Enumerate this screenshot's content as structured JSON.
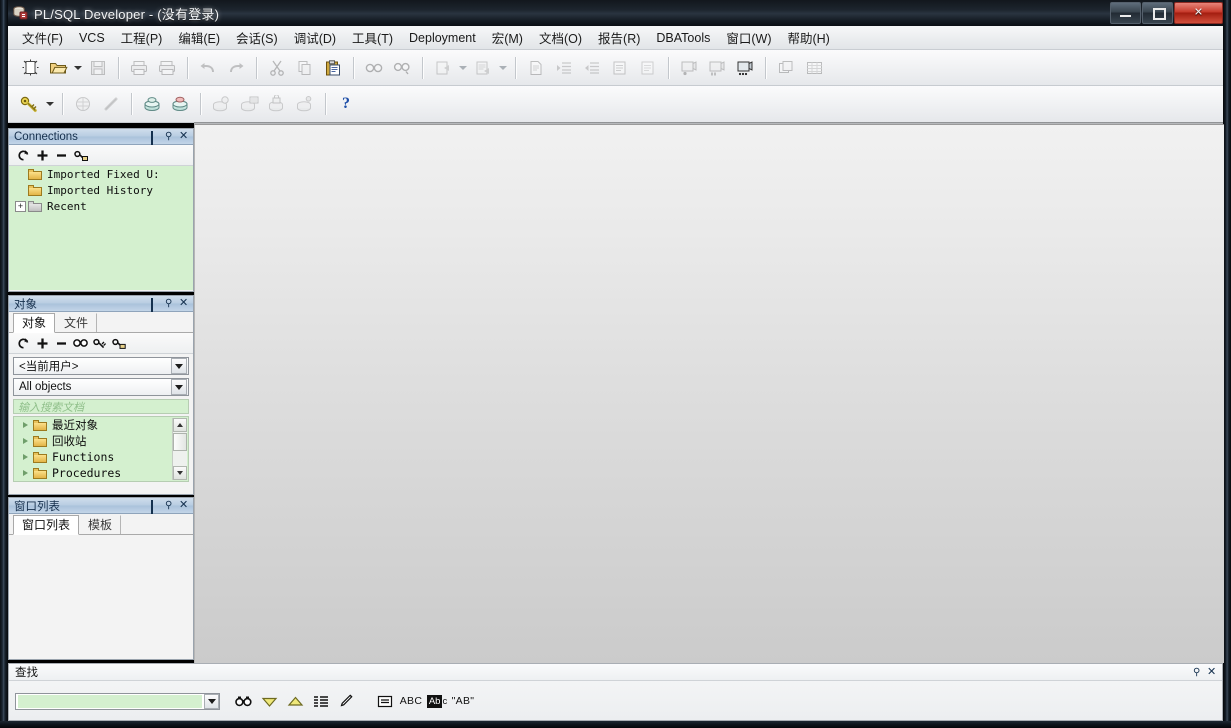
{
  "window": {
    "title": "PL/SQL Developer - (没有登录)",
    "app_icon": "plsql-developer-icon",
    "minimize": "—",
    "maximize": "❐",
    "close": "✕"
  },
  "menubar": {
    "items": [
      {
        "label": "文件(F)"
      },
      {
        "label": "VCS"
      },
      {
        "label": "工程(P)"
      },
      {
        "label": "编辑(E)"
      },
      {
        "label": "会话(S)"
      },
      {
        "label": "调试(D)"
      },
      {
        "label": "工具(T)"
      },
      {
        "label": "Deployment"
      },
      {
        "label": "宏(M)"
      },
      {
        "label": "文档(O)"
      },
      {
        "label": "报告(R)"
      },
      {
        "label": "DBATools"
      },
      {
        "label": "窗口(W)"
      },
      {
        "label": "帮助(H)"
      }
    ]
  },
  "toolbar_main": {
    "groups": [
      [
        "new-icon",
        "open-folder-icon",
        "open-dropdown-caret",
        "save-icon"
      ],
      [
        "print-icon",
        "print-preview-icon"
      ],
      [
        "undo-icon",
        "redo-icon"
      ],
      [
        "cut-icon",
        "copy-icon",
        "paste-icon"
      ],
      [
        "find-icon",
        "find-next-icon"
      ],
      [
        "execute-icon",
        "execute-dropdown-caret",
        "run-script-icon",
        "run-dropdown-caret"
      ],
      [
        "explain-plan-icon",
        "indent-icon",
        "outdent-icon",
        "comment-icon",
        "uncomment-icon"
      ],
      [
        "step-into-icon",
        "step-over-icon",
        "step-out-icon"
      ],
      [
        "tile-windows-icon",
        "grid-icon"
      ]
    ]
  },
  "toolbar_secondary": {
    "groups": [
      [
        "login-key-icon",
        "login-dropdown-caret"
      ],
      [
        "sql-window-icon",
        "command-window-icon"
      ],
      [
        "new-session-icon",
        "end-session-icon"
      ],
      [
        "db-info-icon",
        "db-list-icon",
        "db-lock-icon",
        "db-user-icon"
      ],
      [
        "help-question-icon"
      ]
    ],
    "help_label": "?"
  },
  "connections_panel": {
    "title": "Connections",
    "buttons": {
      "restore": "❐",
      "pin": "📌",
      "close": "✕"
    },
    "toolbar": [
      "refresh-icon",
      "add-icon",
      "remove-icon",
      "edit-connection-icon"
    ],
    "tree": [
      {
        "label": "Imported Fixed U:",
        "expander": "",
        "icon": "folder-icon"
      },
      {
        "label": "Imported History",
        "expander": "",
        "icon": "folder-icon"
      },
      {
        "label": "Recent",
        "expander": "+",
        "icon": "folder-gray-icon"
      }
    ]
  },
  "objects_panel": {
    "title": "对象",
    "tabs": [
      {
        "label": "对象",
        "active": true
      },
      {
        "label": "文件",
        "active": false
      }
    ],
    "toolbar": [
      "refresh-icon",
      "add-icon",
      "remove-icon",
      "find-icon",
      "filter-icon",
      "folder-key-icon"
    ],
    "user_select": {
      "value": "<当前用户>"
    },
    "filter_select": {
      "value": "All objects"
    },
    "search_input": {
      "placeholder": "输入搜索文档",
      "value": ""
    },
    "tree": [
      {
        "label": "最近对象"
      },
      {
        "label": "回收站"
      },
      {
        "label": "Functions"
      },
      {
        "label": "Procedures"
      }
    ]
  },
  "window_list_panel": {
    "title": "窗口列表",
    "tabs": [
      {
        "label": "窗口列表",
        "active": true
      },
      {
        "label": "模板",
        "active": false
      }
    ]
  },
  "find_bar": {
    "title": "查找",
    "input_value": "",
    "buttons": [
      {
        "name": "find-binoculars-icon",
        "label": "🔍"
      },
      {
        "name": "find-next-down-icon",
        "label": "▼"
      },
      {
        "name": "find-prev-up-icon",
        "label": "▲"
      },
      {
        "name": "find-all-list-icon",
        "label": "▤"
      },
      {
        "name": "highlight-pencil-icon",
        "label": "✎"
      },
      {
        "name": "find-options-icon",
        "label": "▤"
      },
      {
        "name": "whole-word-icon",
        "label": "ABC"
      },
      {
        "name": "match-case-icon",
        "label": "Abc"
      },
      {
        "name": "regex-icon",
        "label": "\"AB\""
      }
    ],
    "pin": "📌",
    "close": "✕"
  },
  "colors": {
    "title_bar": "#1d252e",
    "panel_header": "#b9cde2",
    "tree_background": "#d4f0cf",
    "mdi_top": "#f1f1f1",
    "mdi_bottom": "#cbcbcb",
    "accent_close": "#c63a2b",
    "help_blue": "#1f4fa8"
  }
}
